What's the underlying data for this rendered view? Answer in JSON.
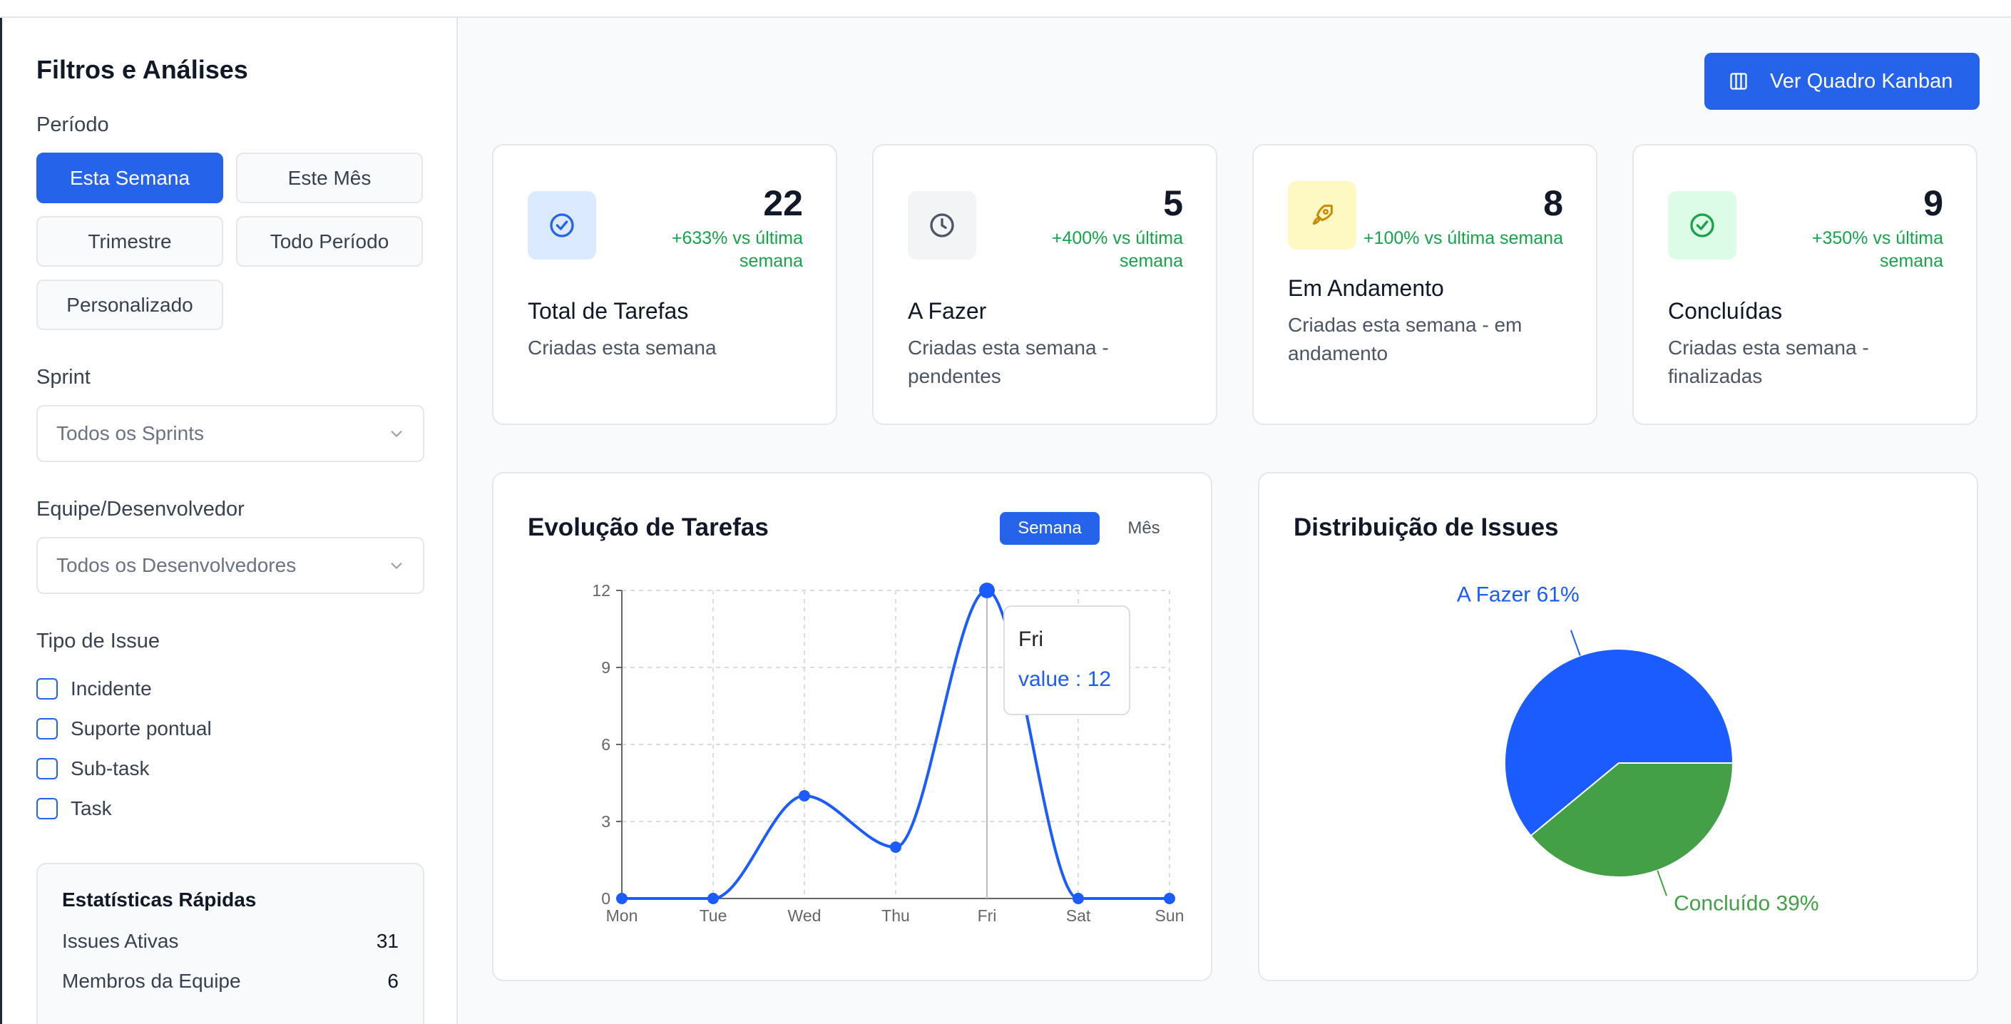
{
  "sidebar": {
    "title": "Filtros e Análises",
    "period_label": "Período",
    "periods": [
      "Esta Semana",
      "Este Mês",
      "Trimestre",
      "Todo Período",
      "Personalizado"
    ],
    "sprint_label": "Sprint",
    "sprint_value": "Todos os Sprints",
    "team_label": "Equipe/Desenvolvedor",
    "team_value": "Todos os Desenvolvedores",
    "issue_type_label": "Tipo de Issue",
    "issue_types": [
      "Incidente",
      "Suporte pontual",
      "Sub-task",
      "Task"
    ],
    "quick_stats": {
      "title": "Estatísticas Rápidas",
      "rows": [
        {
          "label": "Issues Ativas",
          "value": "31"
        },
        {
          "label": "Membros da Equipe",
          "value": "6"
        }
      ]
    }
  },
  "header": {
    "kanban_button": "Ver Quadro Kanban"
  },
  "cards": [
    {
      "value": "22",
      "change": "+633% vs última semana",
      "title": "Total de Tarefas",
      "subtitle": "Criadas esta semana",
      "icon": "check-circle-icon"
    },
    {
      "value": "5",
      "change": "+400% vs última semana",
      "title": "A Fazer",
      "subtitle": "Criadas esta semana - pendentes",
      "icon": "clock-icon"
    },
    {
      "value": "8",
      "change": "+100% vs última semana",
      "title": "Em Andamento",
      "subtitle": "Criadas esta semana - em andamento",
      "icon": "rocket-icon"
    },
    {
      "value": "9",
      "change": "+350% vs última semana",
      "title": "Concluídas",
      "subtitle": "Criadas esta semana - finalizadas",
      "icon": "check-circle-icon"
    }
  ],
  "evolution": {
    "title": "Evolução de Tarefas",
    "toggle": [
      "Semana",
      "Mês"
    ],
    "tooltip": {
      "title": "Fri",
      "label": "value : 12"
    }
  },
  "distribution": {
    "title": "Distribuição de Issues"
  },
  "colors": {
    "primary": "#2563eb",
    "line": "#1a5cff",
    "green": "#43a047",
    "success_text": "#16a34a"
  },
  "chart_data": [
    {
      "type": "line",
      "title": "Evolução de Tarefas",
      "x": [
        "Mon",
        "Tue",
        "Wed",
        "Thu",
        "Fri",
        "Sat",
        "Sun"
      ],
      "series": [
        {
          "name": "value",
          "values": [
            0,
            0,
            4,
            2,
            12,
            0,
            0
          ]
        }
      ],
      "y_ticks": [
        0,
        3,
        6,
        9,
        12
      ],
      "ylim": [
        0,
        12
      ],
      "grid": true
    },
    {
      "type": "pie",
      "title": "Distribuição de Issues",
      "labels": [
        "A Fazer",
        "Concluído"
      ],
      "values": [
        61,
        39
      ],
      "slice_labels": [
        "A Fazer 61%",
        "Concluído 39%"
      ],
      "colors": [
        "#1a5cff",
        "#43a047"
      ]
    }
  ]
}
